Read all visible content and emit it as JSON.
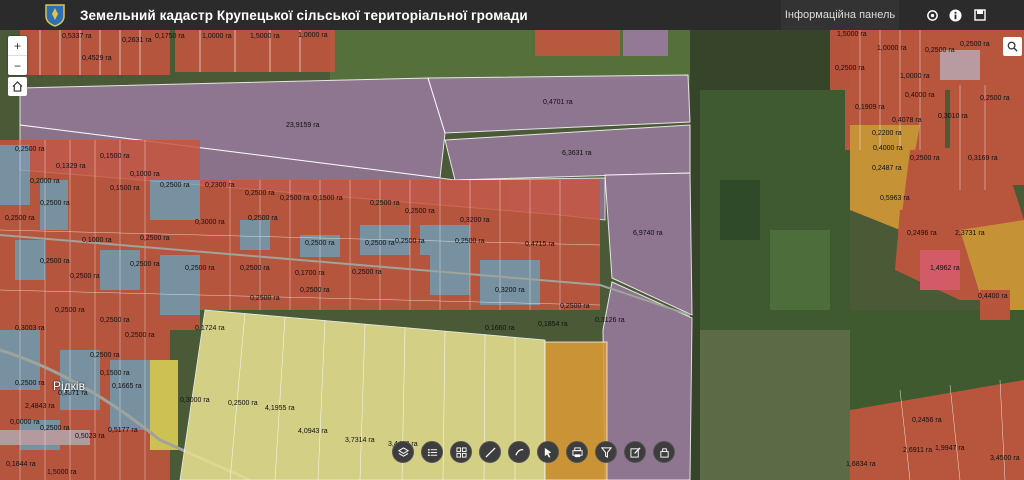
{
  "app": {
    "title": "Земельний кадастр Крупецької сільської територіальної громади",
    "info_panel_label": "Інформаційна панель"
  },
  "header_icons": [
    "settings-icon",
    "info-icon",
    "save-icon"
  ],
  "map_controls": {
    "zoom_in": "+",
    "zoom_out": "−"
  },
  "colors": {
    "parcel_red": "#c8553f",
    "parcel_blue": "#7f9bb3",
    "parcel_purple": "#9a7aa0",
    "parcel_yellow": "#e6e090",
    "parcel_orange": "#d89a36",
    "header_bg": "#2b2b2b"
  },
  "place_label": "Рідків",
  "parcel_labels": [
    "0,5337 га",
    "0,2631 га",
    "0,1750 га",
    "1,0000 га",
    "1,5000 га",
    "1,0000 га",
    "0,4529 га",
    "23,9159 га",
    "0,4701 га",
    "6,3631 га",
    "6,9740 га",
    "0,2500 га",
    "0,1329 га",
    "0,1500 га",
    "0,2000 га",
    "0,1000 га",
    "0,2500 га",
    "0,2300 га",
    "0,2500 га",
    "0,2500 га",
    "0,1500 га",
    "0,2500 га",
    "0,2500 га",
    "0,2500 га",
    "0,2500 га",
    "0,1500 га",
    "0,1000 га",
    "0,2500 га",
    "0,3000 га",
    "0,2500 га",
    "0,2500 га",
    "0,2500 га",
    "0,3200 га",
    "0,4715 га",
    "0,2500 га",
    "0,2500 га",
    "0,2500 га",
    "0,2500 га",
    "0,2500 га",
    "0,2500 га",
    "0,2500 га",
    "0,2500 га",
    "0,2500 га",
    "0,1700 га",
    "0,2500 га",
    "0,3200 га",
    "0,2500 га",
    "0,3126 га",
    "0,1660 га",
    "0,1854 га",
    "0,1724 га",
    "0,3003 га",
    "0,2500 га",
    "0,2500 га",
    "0,2500 га",
    "0,2500 га",
    "0,1500 га",
    "0,2500 га",
    "0,3371 га",
    "0,1665 га",
    "0,2500 га",
    "4,1955 га",
    "4,0943 га",
    "3,7314 га",
    "3,4408 га",
    "2,4843 га",
    "0,0000 га",
    "0,2500 га",
    "0,5023 га",
    "0,5177 га",
    "0,1844 га",
    "1,5000 га",
    "1,5000 га",
    "1,0000 га",
    "0,2500 га",
    "0,2500 га",
    "0,2500 га",
    "1,0000 га",
    "0,1909 га",
    "0,4000 га",
    "0,2500 га",
    "0,4078 га",
    "0,3010 га",
    "0,2200 га",
    "0,4000 га",
    "0,2487 га",
    "0,2500 га",
    "0,3169 га",
    "0,5963 га",
    "0,2496 га",
    "2,3731 га",
    "1,4962 га",
    "0,4400 га",
    "0,2456 га",
    "2,6911 га",
    "1,6834 га",
    "1,9947 га",
    "3,4500 га",
    "0,3000 га",
    "0,0000 га"
  ],
  "tools": [
    "layers-icon",
    "legend-icon",
    "basemap-icon",
    "measure-icon",
    "draw-icon",
    "select-icon",
    "print-icon",
    "filter-icon",
    "edit-icon",
    "share-icon"
  ]
}
